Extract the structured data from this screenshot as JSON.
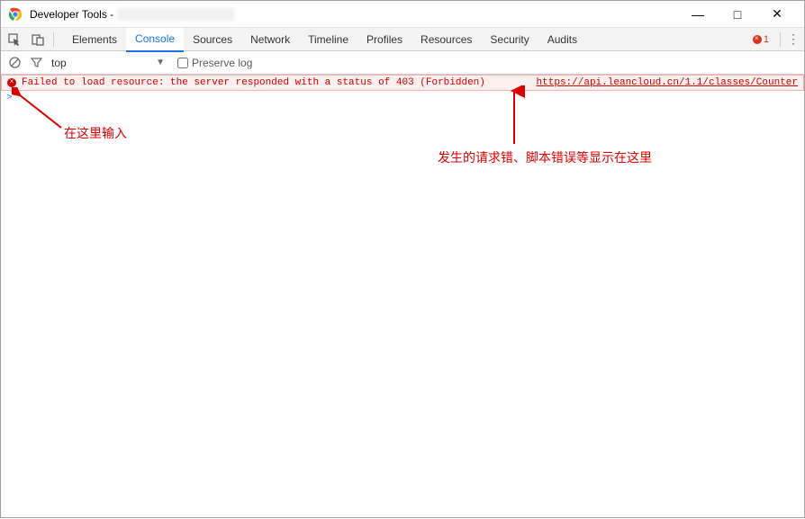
{
  "window": {
    "title": "Developer Tools -",
    "min": "—",
    "max": "□",
    "close": "✕"
  },
  "tabs": {
    "items": [
      "Elements",
      "Console",
      "Sources",
      "Network",
      "Timeline",
      "Profiles",
      "Resources",
      "Security",
      "Audits"
    ],
    "active_index": 1,
    "error_count": "1",
    "menu": "⋮"
  },
  "filter": {
    "context": "top",
    "preserve_label": "Preserve log",
    "preserve_checked": false
  },
  "console": {
    "error": {
      "message": "Failed to load resource: the server responded with a status of 403 (Forbidden)",
      "source": "https://api.leancloud.cn/1.1/classes/Counter"
    },
    "prompt": ">"
  },
  "annotations": {
    "input_hint": "在这里输入",
    "error_hint": "发生的请求错、脚本错误等显示在这里"
  }
}
